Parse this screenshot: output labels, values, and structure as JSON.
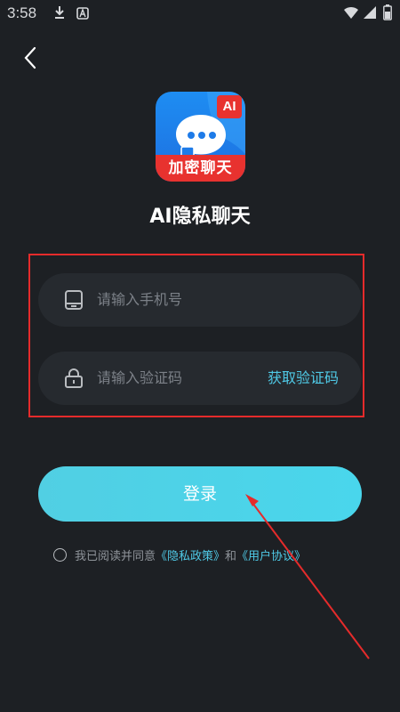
{
  "status_bar": {
    "time": "3:58",
    "icons": [
      "download-icon",
      "notification-a-icon",
      "wifi-icon",
      "signal-icon",
      "battery-icon"
    ]
  },
  "header": {
    "back_icon": "chevron-left-icon"
  },
  "logo": {
    "badge_text": "AI",
    "band_text": "加密聊天",
    "colors": {
      "blue": "#1e8df2",
      "red": "#e8322f"
    }
  },
  "app_name": "AI隐私聊天",
  "form": {
    "phone": {
      "icon": "phone-icon",
      "placeholder": "请输入手机号",
      "value": ""
    },
    "code": {
      "icon": "lock-icon",
      "placeholder": "请输入验证码",
      "value": "",
      "get_code_label": "获取验证码"
    }
  },
  "login_button": {
    "label": "登录",
    "color": "#4fd3e8"
  },
  "agreement": {
    "checked": false,
    "prefix": "我已阅读并同意",
    "privacy_link": "《隐私政策》",
    "conjunction": "和",
    "terms_link": "《用户协议》"
  },
  "annotation": {
    "highlight_color": "#e52b2b"
  }
}
